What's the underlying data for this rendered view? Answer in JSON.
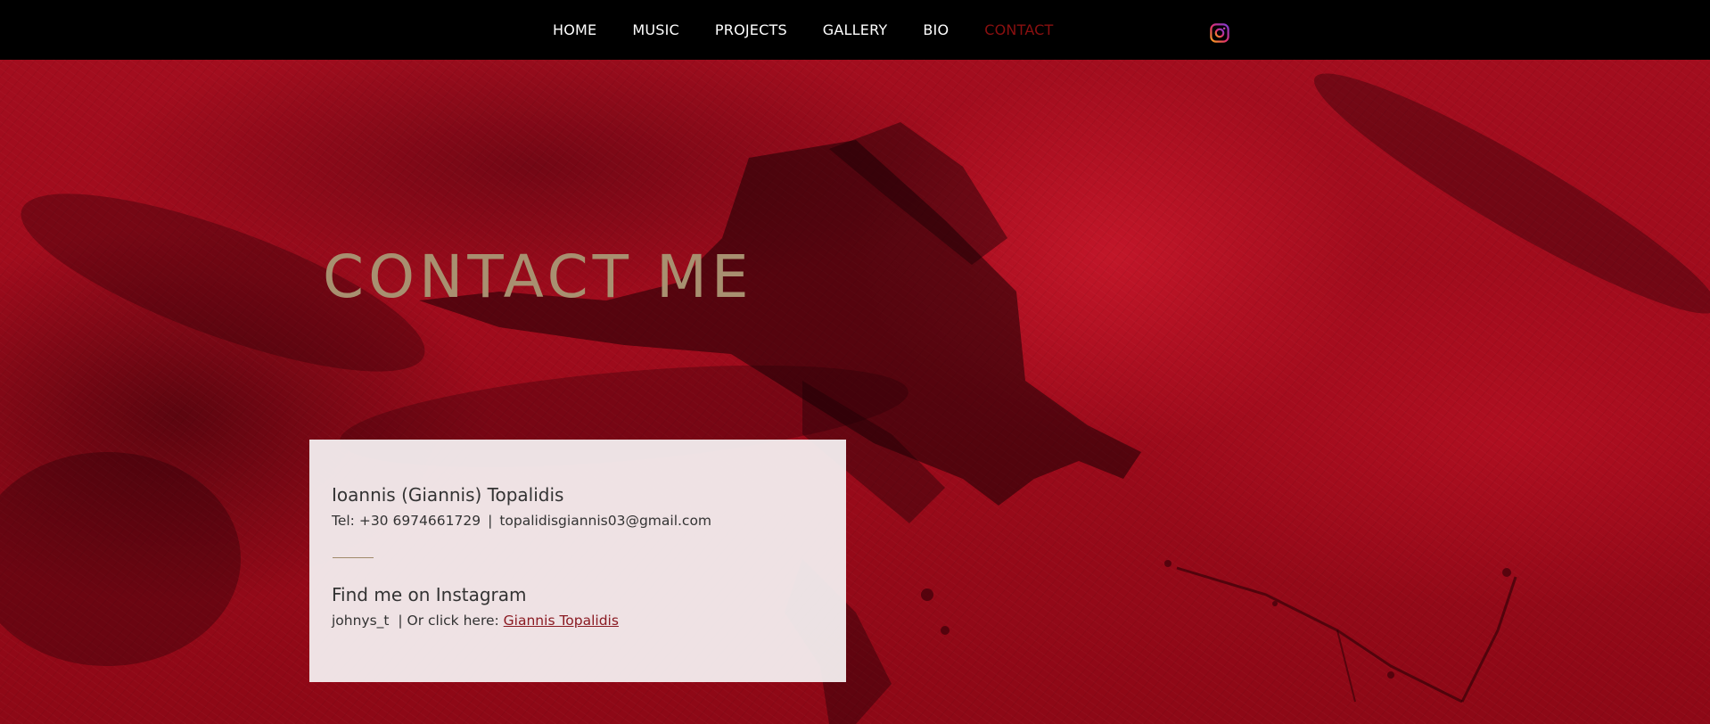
{
  "nav": {
    "items": [
      {
        "label": "HOME",
        "active": false
      },
      {
        "label": "MUSIC",
        "active": false
      },
      {
        "label": "PROJECTS",
        "active": false
      },
      {
        "label": "GALLERY",
        "active": false
      },
      {
        "label": "BIO",
        "active": false
      },
      {
        "label": "CONTACT",
        "active": true
      }
    ],
    "active_color": "#8a1010",
    "social_icon": "instagram-icon"
  },
  "hero": {
    "title": "CONTACT ME",
    "title_color": "#a89070",
    "background_color": "#a00b1c",
    "image": "crow-silhouette"
  },
  "card": {
    "name": "Ioannis (Giannis) Topalidis",
    "phone": "Tel: +30 6974661729",
    "separator": "|",
    "email": "topalidisgiannis03@gmail.com",
    "instagram_heading": "Find me on Instagram",
    "instagram_handle": "johnys_t",
    "click_text": "| Or click here:",
    "link_text": "Giannis Topalidis",
    "link_color": "#8a1a22"
  }
}
